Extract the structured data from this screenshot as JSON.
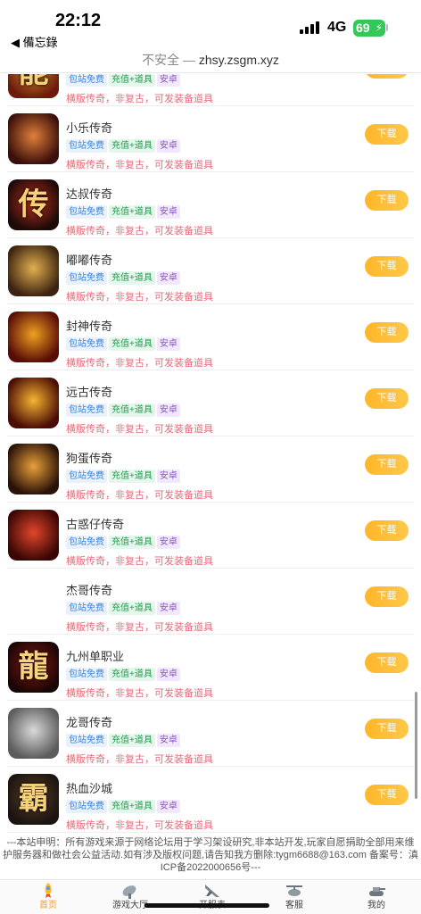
{
  "status": {
    "time": "22:12",
    "back_app": "◀ 備忘錄",
    "network": "4G",
    "battery": "69"
  },
  "url_bar": {
    "insecure": "不安全",
    "separator": " — ",
    "domain": "zhsy.zsgm.xyz"
  },
  "tag_labels": {
    "free": "包站免费",
    "recharge": "充值+道具",
    "os": "安卓"
  },
  "download_label": "下载",
  "games": [
    {
      "name": "",
      "desc": "横版传奇，非复古，可发装备道具",
      "icon": "能",
      "color1": "#6b1a0b",
      "color2": "#d18a2a"
    },
    {
      "name": "小乐传奇",
      "desc": "横版传奇，非复古，可发装备道具",
      "icon": "",
      "color1": "#3b0f0a",
      "color2": "#e0803a"
    },
    {
      "name": "达叔传奇",
      "desc": "横版传奇，非复古，可发装备道具",
      "icon": "传",
      "color1": "#1c0a08",
      "color2": "#c2301e"
    },
    {
      "name": "嘟嘟传奇",
      "desc": "横版传奇，非复古，可发装备道具",
      "icon": "",
      "color1": "#3d2410",
      "color2": "#e3b050"
    },
    {
      "name": "封神传奇",
      "desc": "横版传奇，非复古，可发装备道具",
      "icon": "",
      "color1": "#5a0d07",
      "color2": "#f0a020"
    },
    {
      "name": "远古传奇",
      "desc": "横版传奇，非复古，可发装备道具",
      "icon": "",
      "color1": "#4a0c05",
      "color2": "#f7b531"
    },
    {
      "name": "狗蛋传奇",
      "desc": "横版传奇，非复古，可发装备道具",
      "icon": "",
      "color1": "#2a1208",
      "color2": "#e9a03a"
    },
    {
      "name": "古惑仔传奇",
      "desc": "横版传奇，非复古，可发装备道具",
      "icon": "",
      "color1": "#3a0604",
      "color2": "#e2462a"
    },
    {
      "name": "杰哥传奇",
      "desc": "横版传奇，非复古，可发装备道具",
      "icon": "",
      "color1": "",
      "color2": ""
    },
    {
      "name": "九州单职业",
      "desc": "横版传奇，非复古，可发装备道具",
      "icon": "龍",
      "color1": "#1a0606",
      "color2": "#8c1a10"
    },
    {
      "name": "龙哥传奇",
      "desc": "横版传奇，非复古，可发装备道具",
      "icon": "",
      "color1": "#5c5c5c",
      "color2": "#d9d9d9"
    },
    {
      "name": "热血沙城",
      "desc": "横版传奇，非复古，可发装备道具",
      "icon": "霸",
      "color1": "#1b1410",
      "color2": "#5a4128"
    }
  ],
  "disclaimer": "---本站申明：所有游戏来源于网络论坛用于学习架设研究,非本站开发,玩家自愿捐助全部用来维护服务器和做社会公益活动.如有涉及版权问题,请告知我方删除:tygm6688@163.com 备案号：滇ICP备2022000656号---",
  "bottom_nav": [
    {
      "label": "首页",
      "active": true
    },
    {
      "label": "游戏大厅",
      "active": false
    },
    {
      "label": "开服表",
      "active": false
    },
    {
      "label": "客服",
      "active": false
    },
    {
      "label": "我的",
      "active": false
    }
  ],
  "colors": {
    "accent": "#ffb629",
    "desc": "#e46c7a",
    "free_tag": "#3a84d8",
    "recharge_tag": "#1b9e4b",
    "os_tag": "#8a55d1"
  }
}
